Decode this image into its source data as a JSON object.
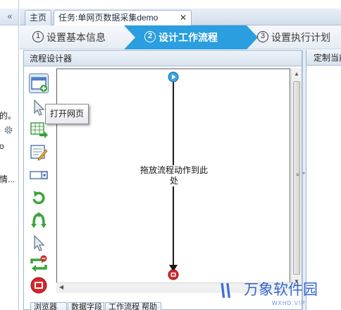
{
  "left_panel": {
    "collapse_glyph": "«",
    "fragments": [
      "的。",
      "o",
      "情..."
    ],
    "icon": "gear-icon"
  },
  "tabs": [
    {
      "label": "主页",
      "active": false
    },
    {
      "label": "任务:单网页数据采集demo",
      "active": true,
      "close_glyph": "✕"
    }
  ],
  "wizard": {
    "steps": [
      {
        "num": "1",
        "label": "设置基本信息",
        "active": false
      },
      {
        "num": "2",
        "label": "设计工作流程",
        "active": true
      },
      {
        "num": "3",
        "label": "设置执行计划",
        "active": false
      }
    ],
    "active_color": "#2a9ede"
  },
  "designer": {
    "title": "流程设计器",
    "tools": [
      "open-page-icon",
      "click-pointer-icon",
      "extract-data-icon",
      "input-text-icon",
      "select-dropdown-icon",
      "loop-icon",
      "condition-icon",
      "mouse-hover-icon",
      "loop-refresh-icon",
      "stop-icon"
    ],
    "tooltip": "打开网页",
    "drop_hint": "拖放流程动作到此处",
    "scroll_grip": "≡"
  },
  "bottom_tabs": [
    "浏览器",
    "数据字段",
    "工作流程 帮助"
  ],
  "right_panel": {
    "title": "定制当前"
  },
  "watermark": {
    "mark": "\\\\",
    "name": "万象软件园",
    "url": "WXHD.VIP"
  },
  "colors": {
    "accent": "#2a9ede",
    "panel_border": "#9fb4cf",
    "start_node": "#39a4e2",
    "end_node": "#d8262b"
  }
}
